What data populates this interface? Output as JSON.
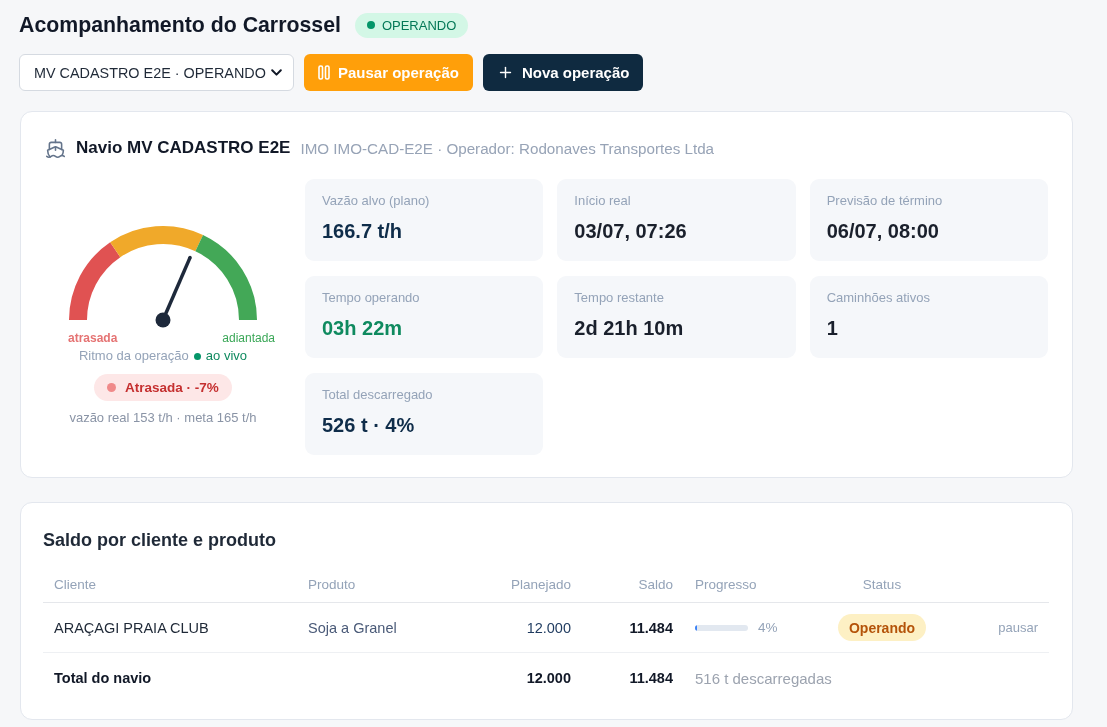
{
  "header": {
    "title": "Acompanhamento do Carrossel",
    "status_badge": "OPERANDO"
  },
  "toolbar": {
    "ship_select": {
      "value": "MV CADASTRO E2E · OPERANDO"
    },
    "buttons": [
      {
        "kind": "pause",
        "label": "Pausar operação"
      },
      {
        "kind": "new",
        "label": "Nova operação"
      }
    ]
  },
  "ship_card": {
    "title": "Navio MV CADASTRO E2E",
    "subtitle": "IMO IMO-CAD-E2E · Operador: Rodonaves Transportes Ltda",
    "gauge": {
      "level": 0.63,
      "low_label": "atrasada",
      "high_label": "adiantada",
      "caption": "Ritmo da operação",
      "live_label": "ao vivo",
      "status_pill": "Atrasada · -7%",
      "note": "vazão real 153 t/h · meta 165 t/h"
    },
    "metrics": [
      {
        "label": "Vazão alvo (plano)",
        "value": "166.7 t/h",
        "color": "#0f2d4a"
      },
      {
        "label": "Início real",
        "value": "03/07, 07:26",
        "color": "#1a202c"
      },
      {
        "label": "Previsão de término",
        "value": "06/07, 08:00",
        "color": "#1a202c"
      },
      {
        "label": "Tempo operando",
        "value": "03h 22m",
        "color": "#0f8a5f"
      },
      {
        "label": "Tempo restante",
        "value": "2d 21h 10m",
        "color": "#1a202c"
      },
      {
        "label": "Caminhões ativos",
        "value": "1",
        "color": "#1a202c"
      },
      {
        "label": "Total descarregado",
        "value": "526 t · 4%",
        "color": "#0f2d4a"
      }
    ]
  },
  "balance_table": {
    "title": "Saldo por cliente e produto",
    "columns": [
      "Cliente",
      "Produto",
      "Planejado",
      "Saldo",
      "Progresso",
      "Status"
    ],
    "rows": [
      {
        "cliente": "ARAÇAGI PRAIA CLUB",
        "produto": "Soja a Granel",
        "planejado": "12.000",
        "saldo": "11.484",
        "progress": {
          "level": 0.04,
          "reading": "4%"
        },
        "status": "Operando",
        "action": "pausar"
      }
    ],
    "total": {
      "label": "Total do navio",
      "planejado": "12.000",
      "saldo": "11.484",
      "progress_note": "516 t descarregadas"
    }
  }
}
